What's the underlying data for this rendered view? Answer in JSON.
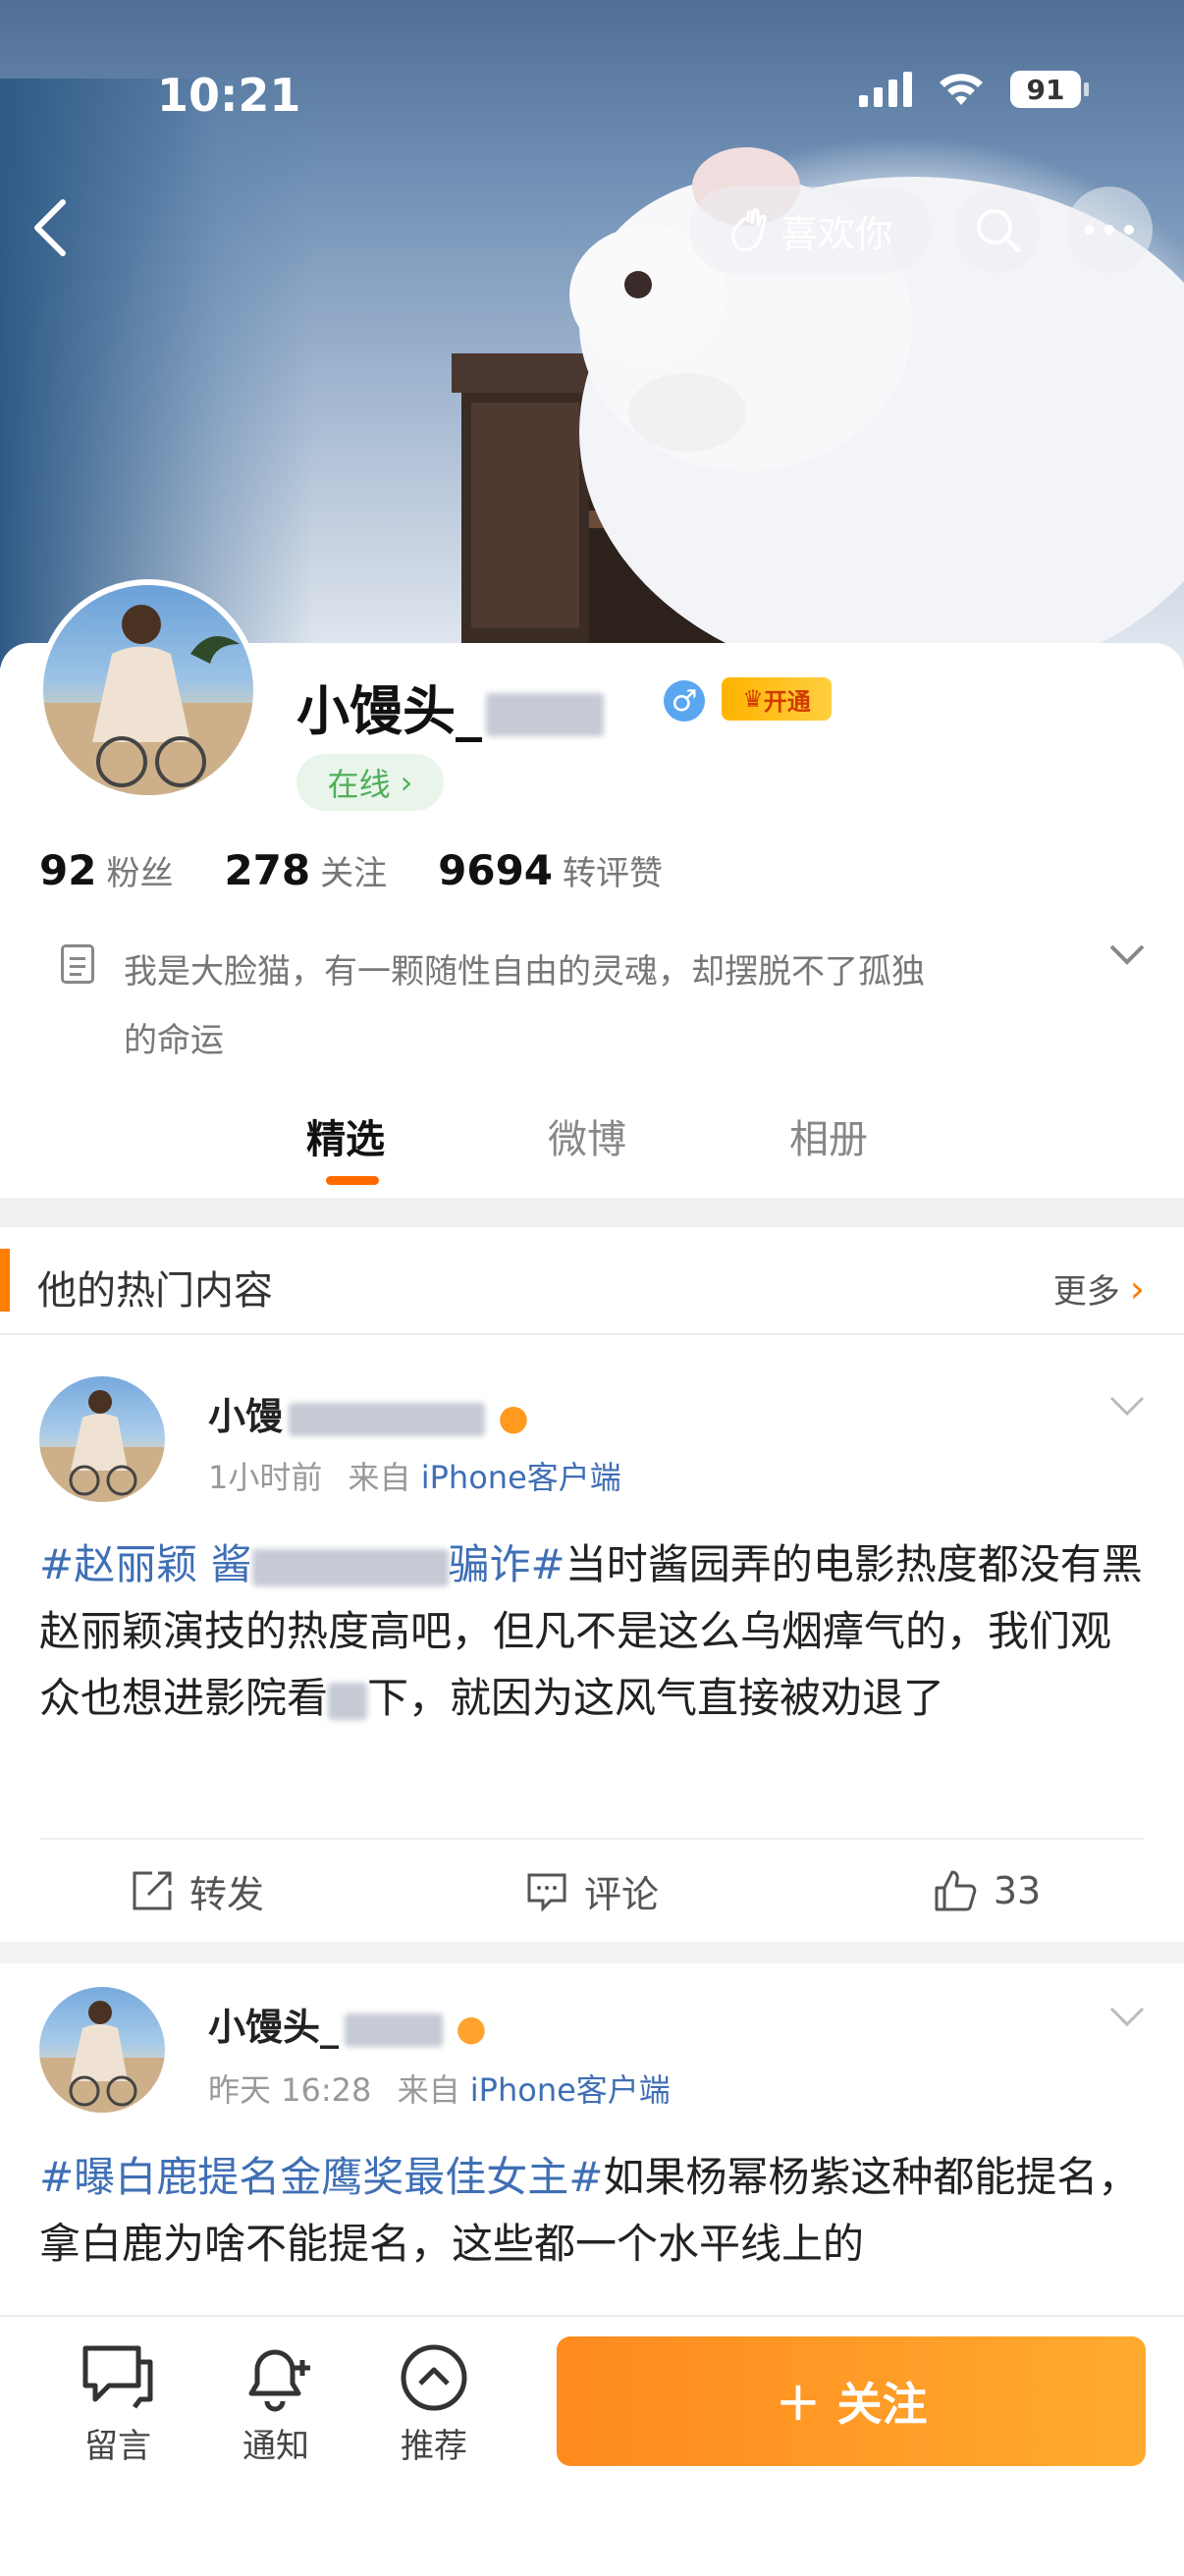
{
  "status_bar": {
    "time": "10:21",
    "battery": "91"
  },
  "header": {
    "like_label": "喜欢你"
  },
  "profile": {
    "username": "小馒头_",
    "gender_symbol": "♂",
    "vip_label": "开通",
    "online_label": "在线",
    "stats": [
      {
        "value": "92",
        "label": "粉丝"
      },
      {
        "value": "278",
        "label": "关注"
      },
      {
        "value": "9694",
        "label": "转评赞"
      }
    ],
    "bio": "我是大脸猫，有一颗随性自由的灵魂，却摆脱不了孤独的命运"
  },
  "tabs": [
    {
      "label": "精选",
      "active": true
    },
    {
      "label": "微博",
      "active": false
    },
    {
      "label": "相册",
      "active": false
    }
  ],
  "hot_section": {
    "title": "他的热门内容",
    "more_label": "更多"
  },
  "posts": [
    {
      "name": "小馒",
      "time": "1小时前",
      "from_prefix": "来自",
      "source": "iPhone客户端",
      "tag": "#赵丽颖 酱",
      "tag_end": "骗诈#",
      "text_a": "当时酱园弄的电影热度都没有黑赵丽颖演技的热度高吧，但凡不是这么乌烟瘴气的，我们观众也想进影院看",
      "text_b": "下，就因为这风气直接被劝退了",
      "repost_label": "转发",
      "comment_label": "评论",
      "likes": "33"
    },
    {
      "name": "小馒头_",
      "time": "昨天 16:28",
      "from_prefix": "来自",
      "source": "iPhone客户端",
      "tag": "#曝白鹿提名金鹰奖最佳女主#",
      "text": "如果杨幂杨紫这种都能提名，拿白鹿为啥不能提名，这些都一个水平线上的"
    }
  ],
  "bottom_bar": {
    "message_label": "留言",
    "notify_label": "通知",
    "recommend_label": "推荐",
    "follow_label": "关注"
  }
}
